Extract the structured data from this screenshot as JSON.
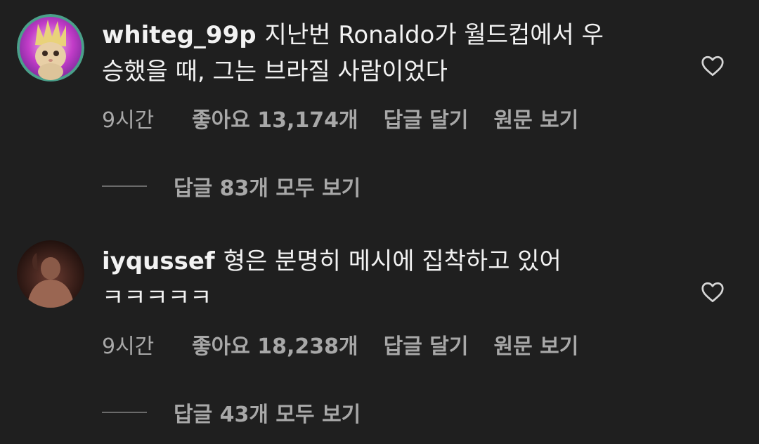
{
  "comments": [
    {
      "username": "whiteg_99p",
      "text_line1": "지난번 Ronaldo가 월드컵에서 우",
      "text_line2": "승했을 때, 그는 브라질 사람이었다",
      "time": "9시간",
      "likes": "좋아요 13,174개",
      "reply_label": "답글 달기",
      "original_label": "원문 보기",
      "view_replies": "답글 83개 모두 보기",
      "avatar_icon": "cat-avatar-icon",
      "like_icon": "heart-outline-icon"
    },
    {
      "username": "iyqussef",
      "text_line1": "형은 분명히 메시에 집착하고 있어",
      "text_line2": "ㅋㅋㅋㅋㅋ",
      "time": "9시간",
      "likes": "좋아요 18,238개",
      "reply_label": "답글 달기",
      "original_label": "원문 보기",
      "view_replies": "답글 43개 모두 보기",
      "avatar_icon": "person-avatar-icon",
      "like_icon": "heart-outline-icon"
    }
  ],
  "colors": {
    "background": "#1f1f1f",
    "primary_text": "#f2f2f2",
    "secondary_text": "#a8a8a8"
  }
}
